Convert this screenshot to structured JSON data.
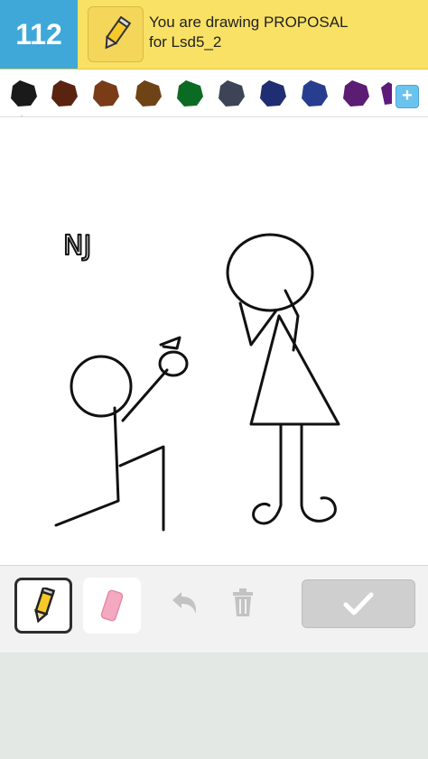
{
  "header": {
    "score": "112",
    "prompt_line1": "You are drawing PROPOSAL",
    "prompt_line2": "for Lsd5_2"
  },
  "palette": {
    "colors": [
      "#1a1a1a",
      "#5a2310",
      "#7a3b17",
      "#6e4316",
      "#0c6b22",
      "#3d4456",
      "#1f2e72",
      "#283d8f",
      "#5b1c73",
      "#5d1a7a"
    ],
    "selected_index": 0,
    "add_label": "+"
  },
  "canvas": {
    "annotation_text": "NJ"
  },
  "toolbar": {
    "active_tool": "pencil",
    "tools": [
      "pencil",
      "eraser",
      "undo",
      "trash",
      "done"
    ]
  }
}
